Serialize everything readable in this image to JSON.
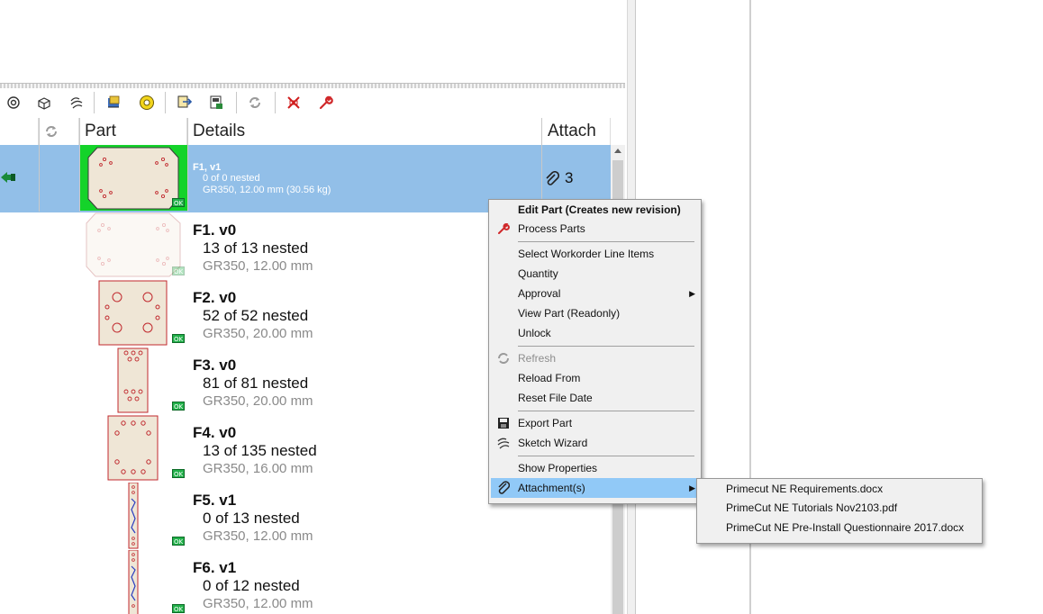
{
  "toolbar": {
    "icons": [
      "target-icon",
      "cube-icon",
      "sketch-icon",
      "nest-icon",
      "circle-yellow-icon",
      "import-icon",
      "export-icon",
      "refresh-icon",
      "delete-red-icon",
      "wrench-icon"
    ]
  },
  "headers": {
    "sync": "",
    "part": "Part",
    "details": "Details",
    "attach": "Attach"
  },
  "rows": [
    {
      "title": "F1, v1",
      "nested": "0 of 0 nested",
      "material": "GR350, 12.00 mm (30.56 kg)",
      "attach_count": "3",
      "status": "OK"
    },
    {
      "title": "F1. v0",
      "nested": "13 of 13 nested",
      "material": "GR350, 12.00 mm",
      "status": "OK"
    },
    {
      "title": "F2. v0",
      "nested": "52 of 52 nested",
      "material": "GR350, 20.00 mm",
      "status": "OK"
    },
    {
      "title": "F3. v0",
      "nested": "81 of 81 nested",
      "material": "GR350, 20.00 mm",
      "status": "OK"
    },
    {
      "title": "F4. v0",
      "nested": "13 of 135 nested",
      "material": "GR350, 16.00 mm",
      "status": "OK"
    },
    {
      "title": "F5. v1",
      "nested": "0 of 13 nested",
      "material": "GR350, 12.00 mm",
      "status": "OK"
    },
    {
      "title": "F6. v1",
      "nested": "0 of 12 nested",
      "material": "GR350, 12.00 mm",
      "status": "OK"
    }
  ],
  "context_menu": {
    "edit_part": "Edit Part (Creates new revision)",
    "process_parts": "Process Parts",
    "select_workorder": "Select Workorder Line Items",
    "quantity": "Quantity",
    "approval": "Approval",
    "view_part": "View Part (Readonly)",
    "unlock": "Unlock",
    "refresh": "Refresh",
    "reload_from": "Reload From",
    "reset_file_date": "Reset File Date",
    "export_part": "Export Part",
    "sketch_wizard": "Sketch Wizard",
    "show_properties": "Show Properties",
    "attachments": "Attachment(s)"
  },
  "attachments_submenu": [
    "Primecut NE Requirements.docx",
    "PrimeCut NE Tutorials Nov2103.pdf",
    "PrimeCut NE Pre-Install Questionnaire 2017.docx"
  ],
  "colors": {
    "selection": "#92bfe8",
    "menu_highlight": "#91c9f7",
    "ok_green": "#22b04a",
    "part_fill": "#efe6d6",
    "part_outline": "#c0282d"
  }
}
